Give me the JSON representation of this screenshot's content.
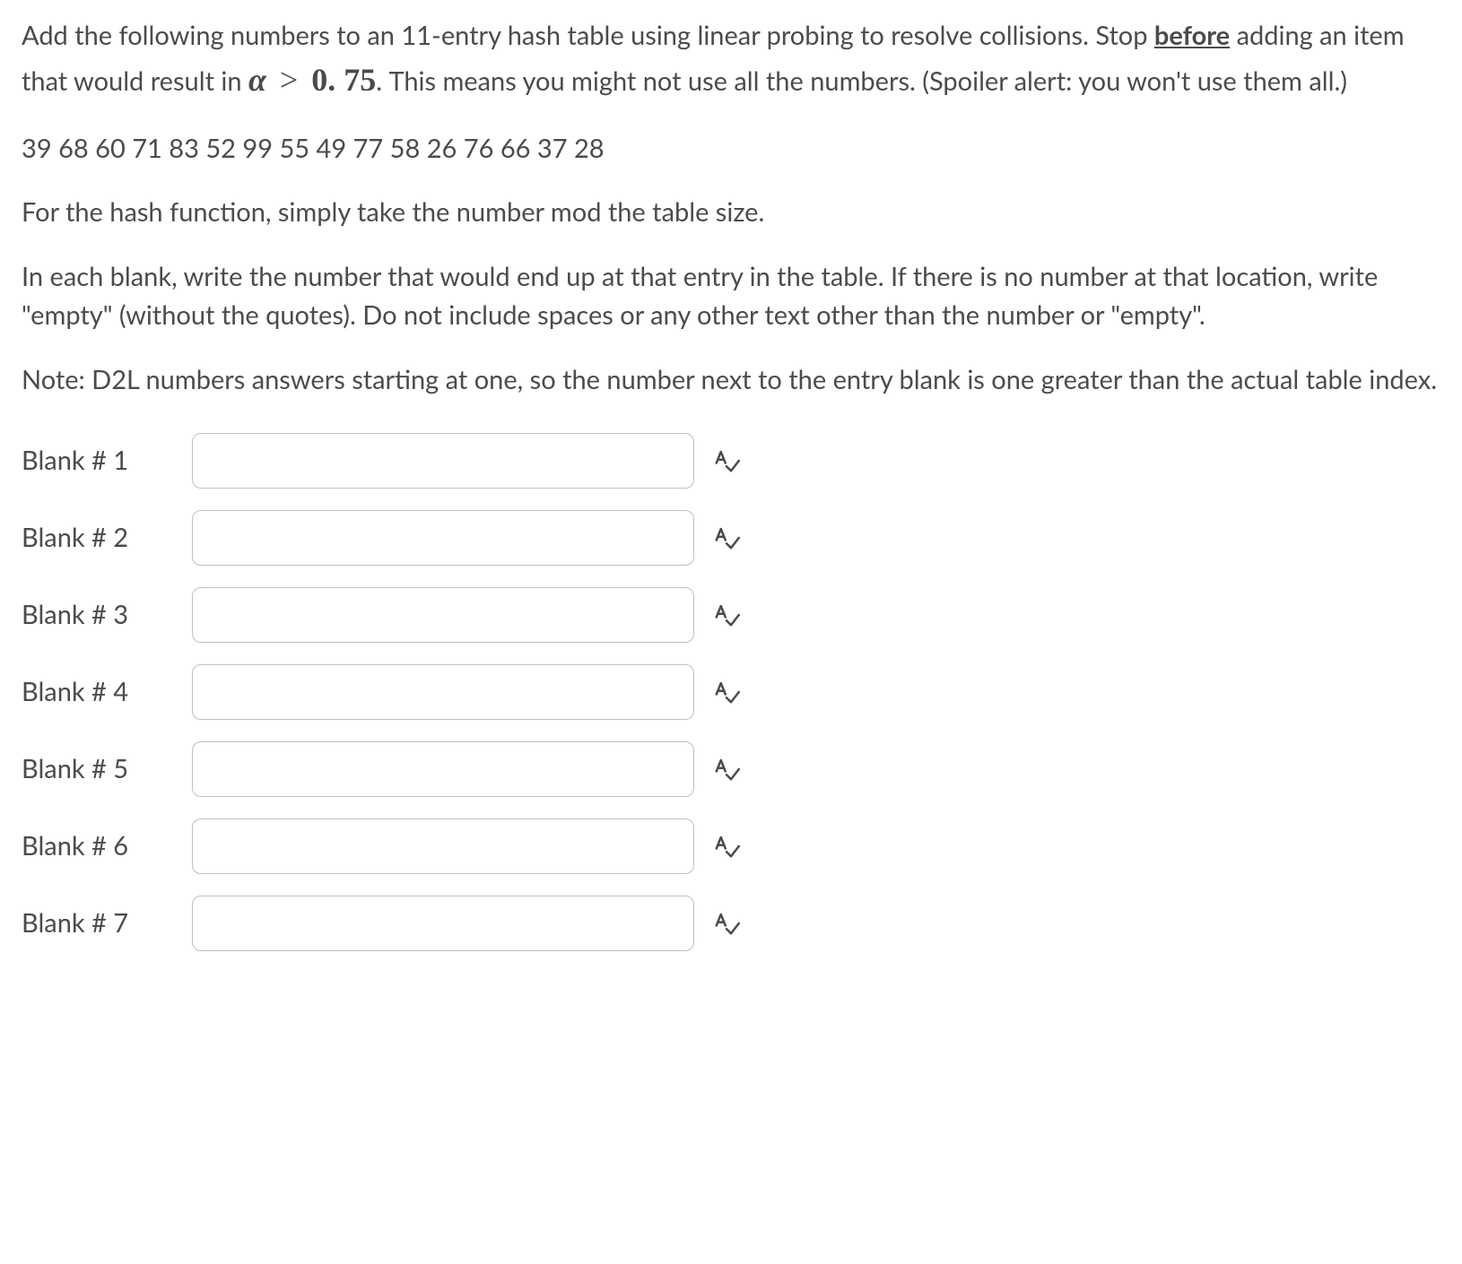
{
  "question": {
    "para1_part1": "Add the following numbers to an 11-entry hash table using linear probing to resolve collisions.  Stop ",
    "para1_before_word": "before",
    "para1_part2": " adding an item that would result in ",
    "formula_alpha": "α",
    "formula_gt": ">",
    "formula_value": "0. 75",
    "para1_part3": ".  This means you might not use all the numbers.  (Spoiler alert: you won't use them all.)",
    "para2": "39 68 60 71 83 52 99 55 49 77 58 26 76 66 37 28",
    "para3": "For the hash function, simply take the number mod the table size.",
    "para4": "In each blank, write the number that would end up at that entry in the table.  If there is no number at that location, write \"empty\" (without the quotes).  Do not include spaces or any other text other than the number or \"empty\".",
    "para5": "Note: D2L numbers answers starting at one, so the number next to the entry blank is one greater than the actual table index."
  },
  "blanks": [
    {
      "label": "Blank # 1",
      "value": ""
    },
    {
      "label": "Blank # 2",
      "value": ""
    },
    {
      "label": "Blank # 3",
      "value": ""
    },
    {
      "label": "Blank # 4",
      "value": ""
    },
    {
      "label": "Blank # 5",
      "value": ""
    },
    {
      "label": "Blank # 6",
      "value": ""
    },
    {
      "label": "Blank # 7",
      "value": ""
    }
  ]
}
